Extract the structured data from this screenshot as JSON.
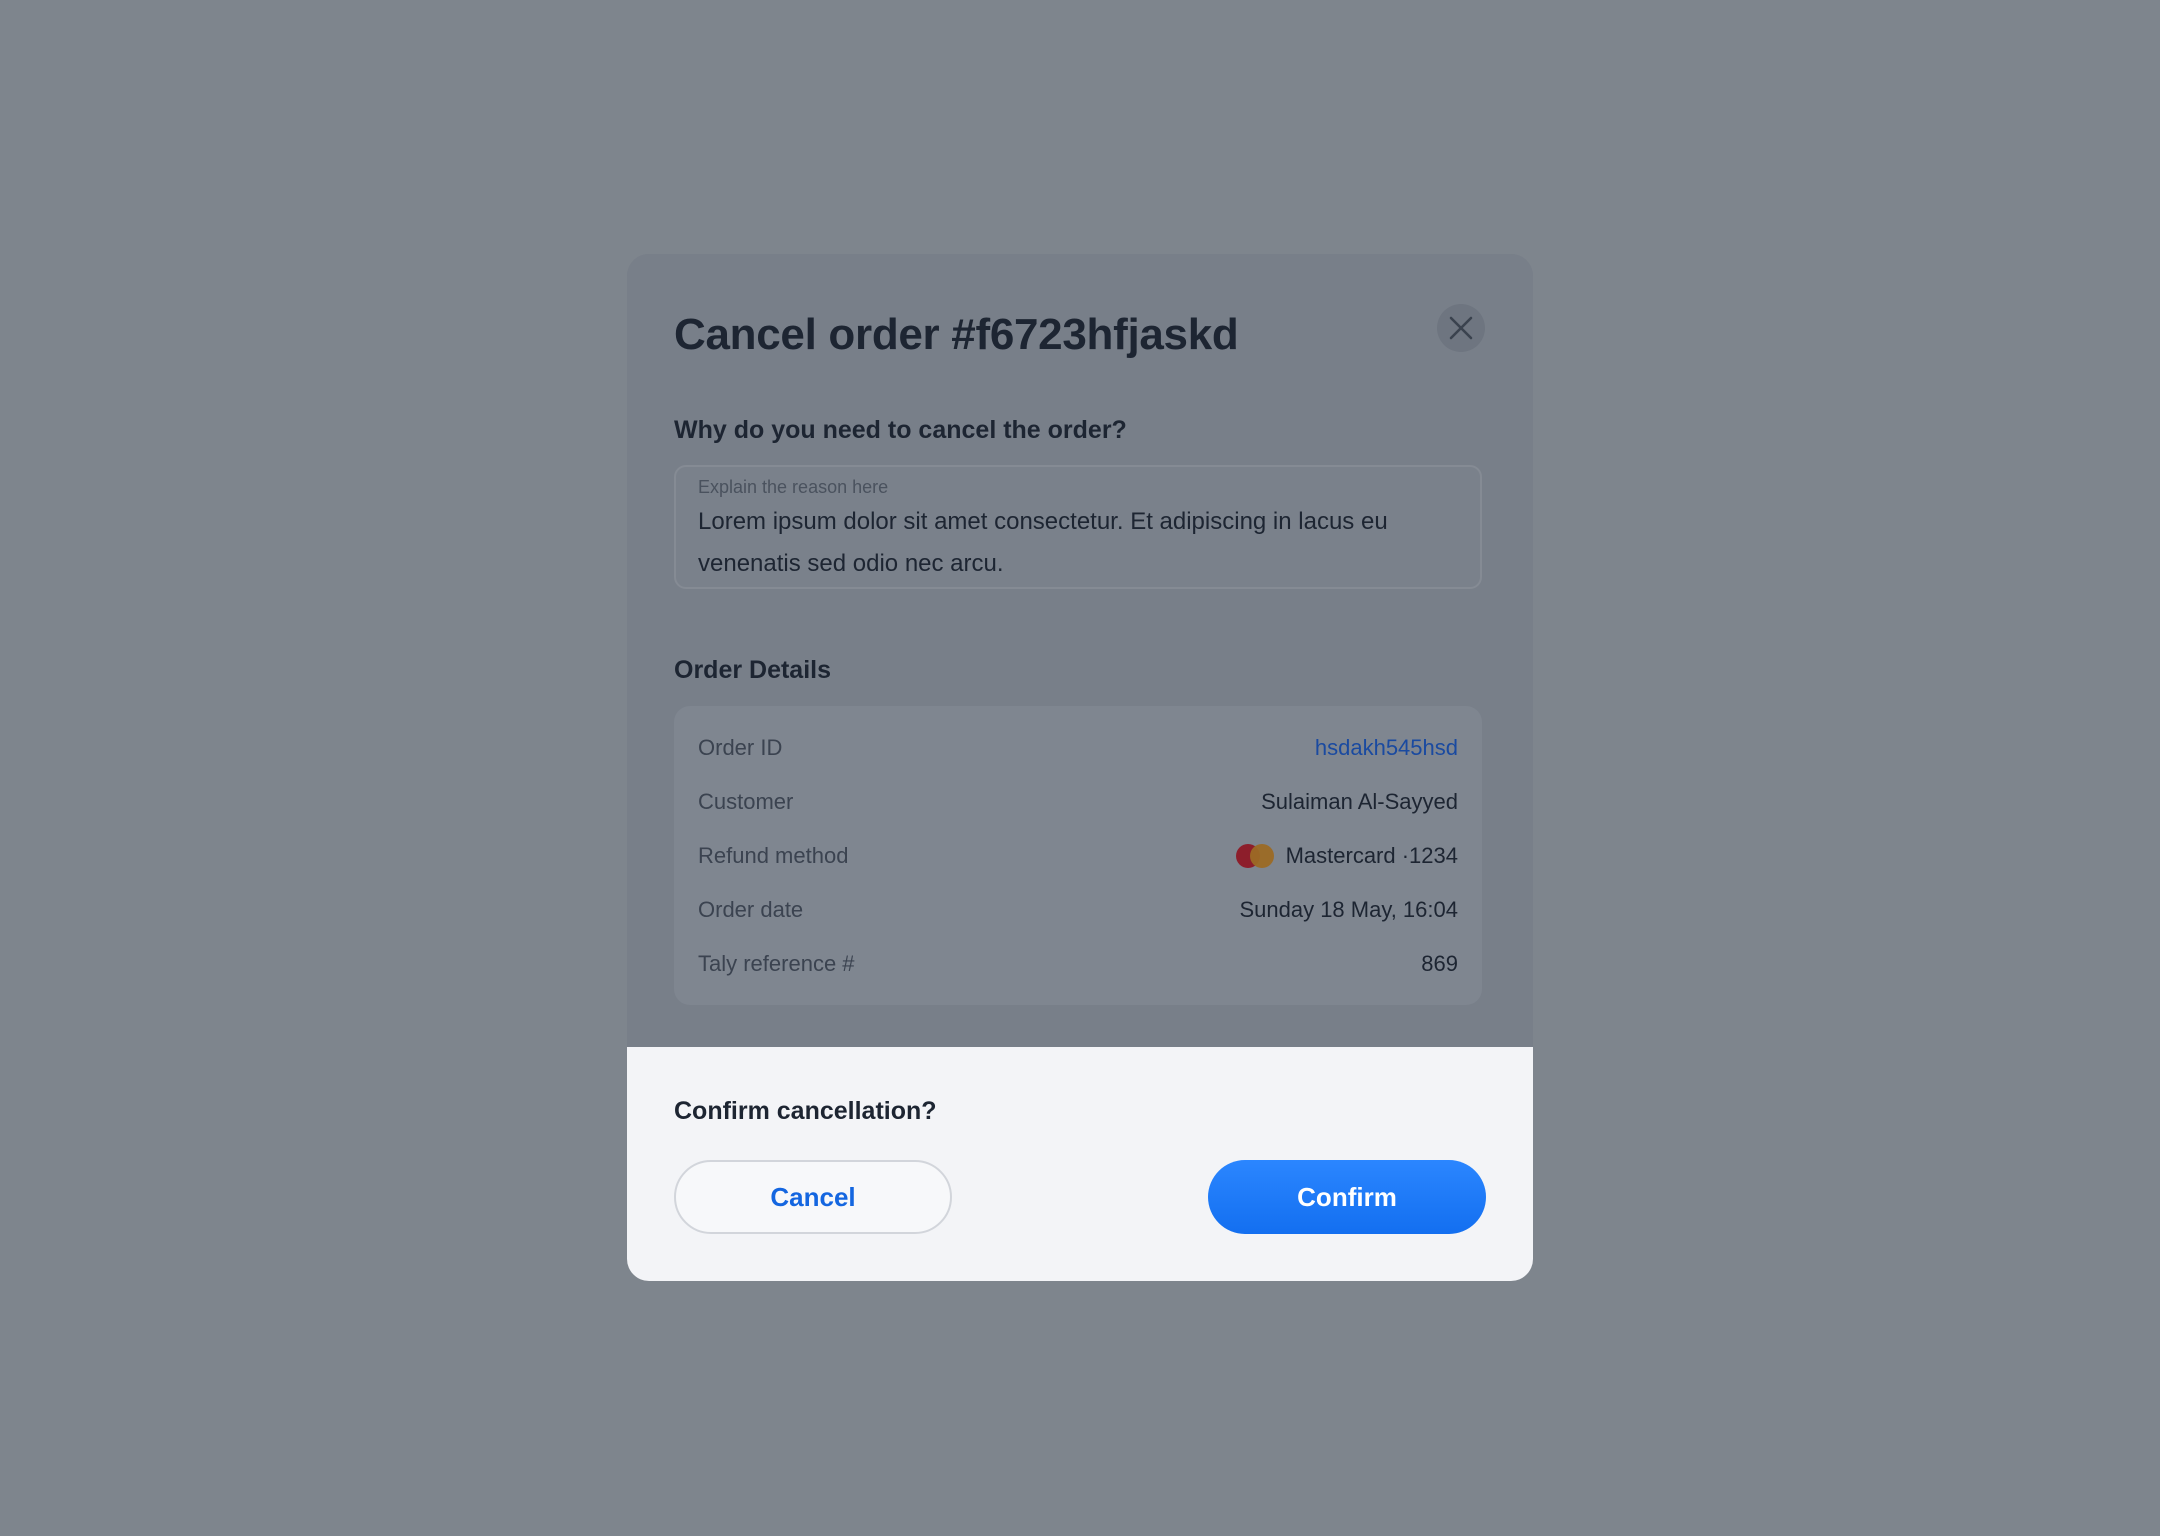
{
  "modal": {
    "title": "Cancel order #f6723hfjaskd",
    "close_icon": "close-icon",
    "reason": {
      "label": "Why do you need to cancel the order?",
      "placeholder": "Explain the reason here",
      "value": "Lorem ipsum dolor sit amet consectetur. Et adipiscing in lacus eu venenatis sed odio nec arcu."
    },
    "details": {
      "heading": "Order Details",
      "rows": [
        {
          "label": "Order ID",
          "value": "hsdakh545hsd"
        },
        {
          "label": "Customer",
          "value": "Sulaiman Al-Sayyed"
        },
        {
          "label": "Refund method",
          "value": "Mastercard ·1234",
          "icon": "mastercard-icon"
        },
        {
          "label": "Order date",
          "value": "Sunday 18 May, 16:04"
        },
        {
          "label": "Taly reference #",
          "value": "869"
        }
      ]
    },
    "footer": {
      "question": "Confirm cancellation?",
      "cancel_label": "Cancel",
      "confirm_label": "Confirm"
    }
  },
  "colors": {
    "backdrop": "#7e858d",
    "text_primary": "#1d2532",
    "link": "#1a4aa0",
    "accent": "#136ff0",
    "footer_bg": "#f3f4f7"
  }
}
